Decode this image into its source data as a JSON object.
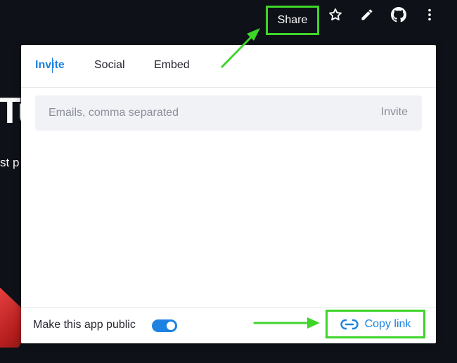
{
  "background": {
    "title_fragment": "Tu",
    "text_fragment": "st p"
  },
  "toolbar": {
    "share_label": "Share",
    "icons": [
      "star-icon",
      "pencil-icon",
      "github-icon",
      "more-vertical-icon"
    ]
  },
  "share_dialog": {
    "tabs": [
      {
        "label": "Invite",
        "active": true
      },
      {
        "label": "Social",
        "active": false
      },
      {
        "label": "Embed",
        "active": false
      }
    ],
    "email_input": {
      "value": "",
      "placeholder": "Emails, comma separated"
    },
    "invite_button": "Invite",
    "public_toggle": {
      "label": "Make this app public",
      "on": true
    },
    "copy_link_label": "Copy link"
  },
  "colors": {
    "background": "#0e1117",
    "accent": "#1c83e1",
    "highlight": "#3fd42a",
    "panel": "#ffffff"
  }
}
